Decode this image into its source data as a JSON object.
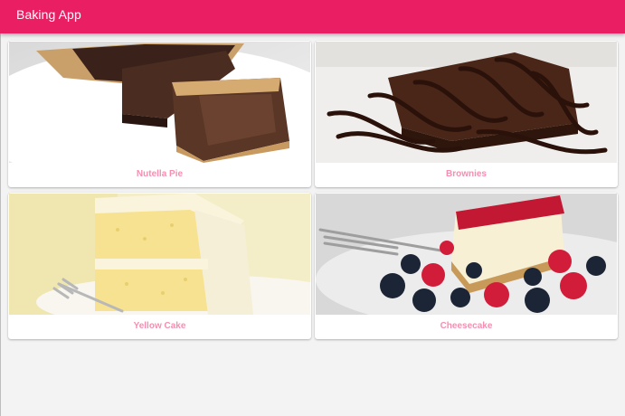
{
  "app": {
    "title": "Baking App",
    "accent_color": "#e91e63",
    "label_color": "#f48fb1"
  },
  "recipes": [
    {
      "name": "Nutella Pie",
      "image": "nutella-pie-photo"
    },
    {
      "name": "Brownies",
      "image": "brownies-photo"
    },
    {
      "name": "Yellow Cake",
      "image": "yellow-cake-photo"
    },
    {
      "name": "Cheesecake",
      "image": "cheesecake-photo"
    }
  ]
}
